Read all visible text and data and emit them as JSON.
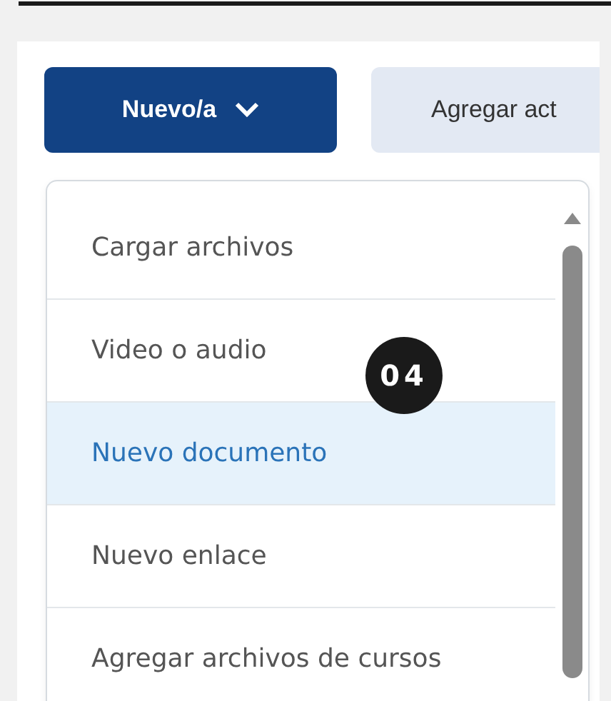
{
  "toolbar": {
    "buttons": [
      {
        "label": "Nuevo/a",
        "kind": "primary",
        "expanded": true
      },
      {
        "label": "Agregar act",
        "kind": "secondary"
      }
    ]
  },
  "menu": {
    "items": [
      {
        "label": "Cargar archivos",
        "selected": false
      },
      {
        "label": "Video o audio",
        "selected": false
      },
      {
        "label": "Nuevo documento",
        "selected": true
      },
      {
        "label": "Nuevo enlace",
        "selected": false
      },
      {
        "label": "Agregar archivos de cursos",
        "selected": false
      }
    ]
  },
  "step_badge": "04"
}
